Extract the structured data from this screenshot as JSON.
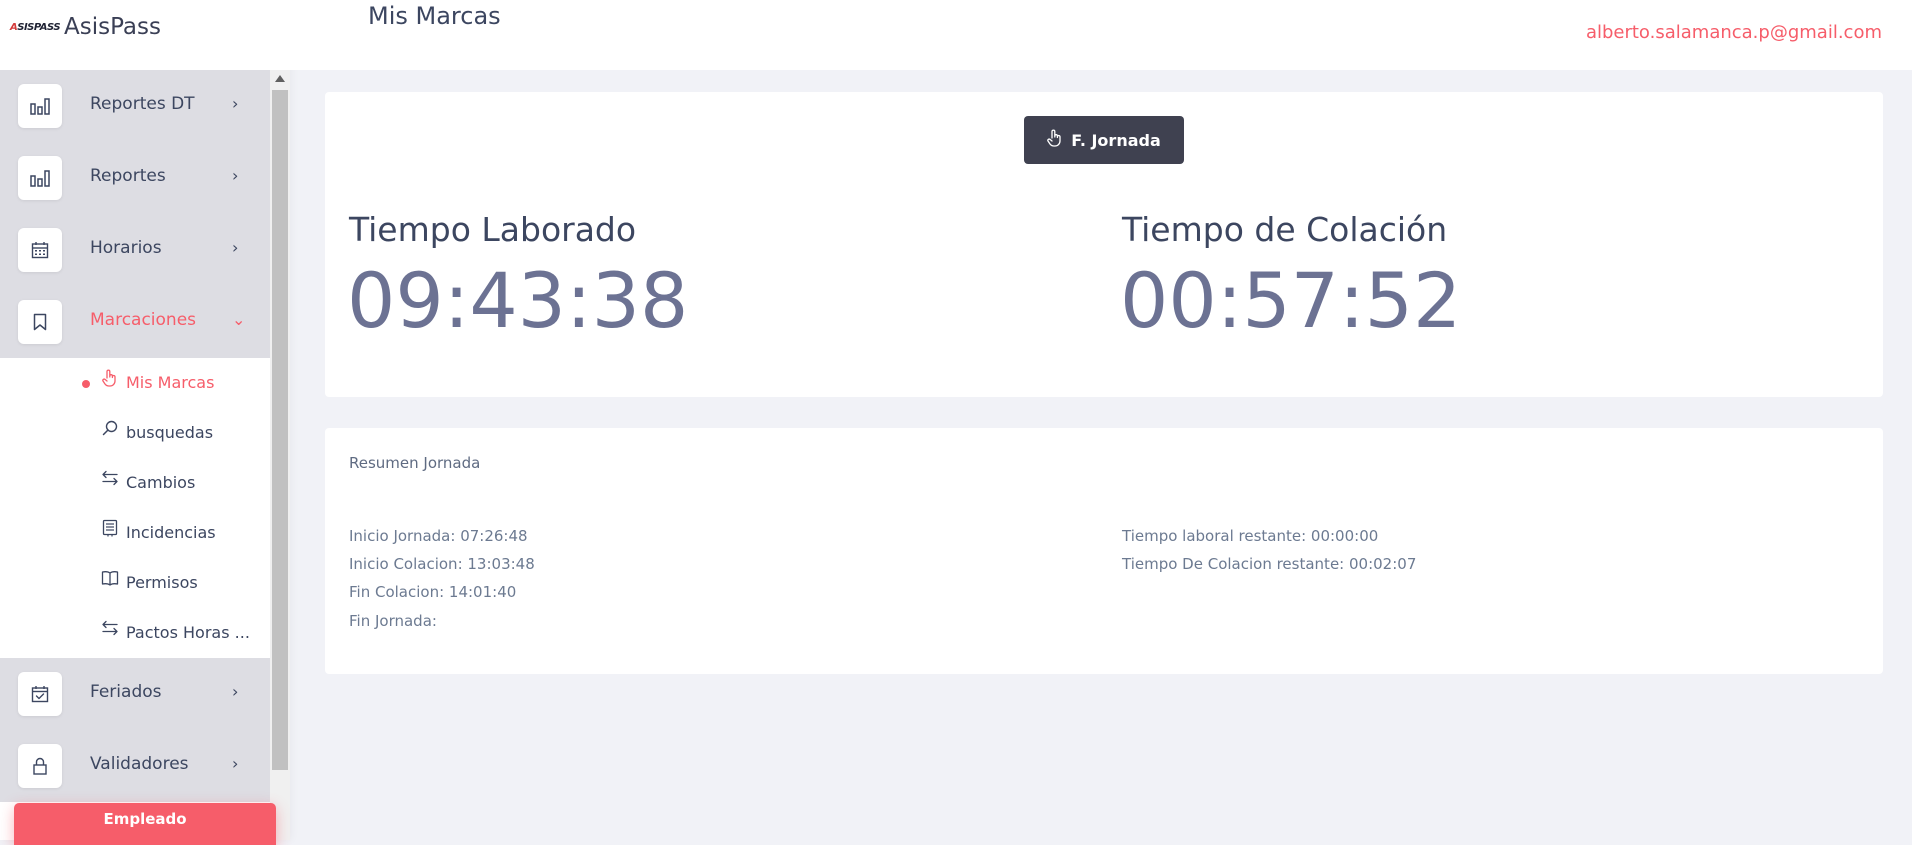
{
  "brand": {
    "logo_text": "ASISPASS",
    "name": "AsisPass"
  },
  "header": {
    "page_title": "Mis Marcas",
    "user_email": "alberto.salamanca.p@gmail.com"
  },
  "sidebar": {
    "items": [
      {
        "label": "Reportes DT",
        "icon": "bar-chart-icon",
        "chevron": "›"
      },
      {
        "label": "Reportes",
        "icon": "bar-chart-icon",
        "chevron": "›"
      },
      {
        "label": "Horarios",
        "icon": "calendar-icon",
        "chevron": "›"
      },
      {
        "label": "Marcaciones",
        "icon": "bookmark-icon",
        "chevron": "⌄"
      },
      {
        "label": "Feriados",
        "icon": "calendar-check-icon",
        "chevron": "›"
      },
      {
        "label": "Validadores",
        "icon": "lock-icon",
        "chevron": "›"
      }
    ],
    "subitems": [
      {
        "label": "Mis Marcas",
        "icon": "hand-pointer-icon"
      },
      {
        "label": "busquedas",
        "icon": "search-icon"
      },
      {
        "label": "Cambios",
        "icon": "swap-icon"
      },
      {
        "label": "Incidencias",
        "icon": "list-icon"
      },
      {
        "label": "Permisos",
        "icon": "book-icon"
      },
      {
        "label": "Pactos Horas ...",
        "icon": "swap-icon"
      }
    ],
    "employee_button": "Empleado"
  },
  "main": {
    "action_button": "F. Jornada",
    "worked": {
      "title": "Tiempo Laborado",
      "value": "09:43:38"
    },
    "lunch": {
      "title": "Tiempo de Colación",
      "value": "00:57:52"
    },
    "summary": {
      "title": "Resumen Jornada",
      "left": [
        "Inicio Jornada: 07:26:48",
        "Inicio Colacion: 13:03:48",
        "Fin Colacion: 14:01:40",
        "Fin Jornada:"
      ],
      "right": [
        "Tiempo laboral restante: 00:00:00",
        "Tiempo De Colacion restante: 00:02:07"
      ]
    }
  },
  "colors": {
    "accent": "#f65d6a",
    "dark_button": "#3f4150",
    "text": "#3c4660"
  }
}
